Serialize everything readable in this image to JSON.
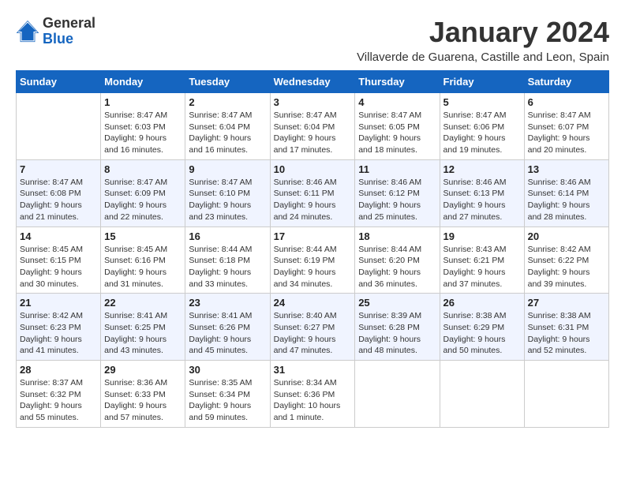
{
  "logo": {
    "general": "General",
    "blue": "Blue"
  },
  "title": "January 2024",
  "subtitle": "Villaverde de Guarena, Castille and Leon, Spain",
  "headers": [
    "Sunday",
    "Monday",
    "Tuesday",
    "Wednesday",
    "Thursday",
    "Friday",
    "Saturday"
  ],
  "weeks": [
    [
      {
        "day": "",
        "info": ""
      },
      {
        "day": "1",
        "info": "Sunrise: 8:47 AM\nSunset: 6:03 PM\nDaylight: 9 hours\nand 16 minutes."
      },
      {
        "day": "2",
        "info": "Sunrise: 8:47 AM\nSunset: 6:04 PM\nDaylight: 9 hours\nand 16 minutes."
      },
      {
        "day": "3",
        "info": "Sunrise: 8:47 AM\nSunset: 6:04 PM\nDaylight: 9 hours\nand 17 minutes."
      },
      {
        "day": "4",
        "info": "Sunrise: 8:47 AM\nSunset: 6:05 PM\nDaylight: 9 hours\nand 18 minutes."
      },
      {
        "day": "5",
        "info": "Sunrise: 8:47 AM\nSunset: 6:06 PM\nDaylight: 9 hours\nand 19 minutes."
      },
      {
        "day": "6",
        "info": "Sunrise: 8:47 AM\nSunset: 6:07 PM\nDaylight: 9 hours\nand 20 minutes."
      }
    ],
    [
      {
        "day": "7",
        "info": "Sunrise: 8:47 AM\nSunset: 6:08 PM\nDaylight: 9 hours\nand 21 minutes."
      },
      {
        "day": "8",
        "info": "Sunrise: 8:47 AM\nSunset: 6:09 PM\nDaylight: 9 hours\nand 22 minutes."
      },
      {
        "day": "9",
        "info": "Sunrise: 8:47 AM\nSunset: 6:10 PM\nDaylight: 9 hours\nand 23 minutes."
      },
      {
        "day": "10",
        "info": "Sunrise: 8:46 AM\nSunset: 6:11 PM\nDaylight: 9 hours\nand 24 minutes."
      },
      {
        "day": "11",
        "info": "Sunrise: 8:46 AM\nSunset: 6:12 PM\nDaylight: 9 hours\nand 25 minutes."
      },
      {
        "day": "12",
        "info": "Sunrise: 8:46 AM\nSunset: 6:13 PM\nDaylight: 9 hours\nand 27 minutes."
      },
      {
        "day": "13",
        "info": "Sunrise: 8:46 AM\nSunset: 6:14 PM\nDaylight: 9 hours\nand 28 minutes."
      }
    ],
    [
      {
        "day": "14",
        "info": "Sunrise: 8:45 AM\nSunset: 6:15 PM\nDaylight: 9 hours\nand 30 minutes."
      },
      {
        "day": "15",
        "info": "Sunrise: 8:45 AM\nSunset: 6:16 PM\nDaylight: 9 hours\nand 31 minutes."
      },
      {
        "day": "16",
        "info": "Sunrise: 8:44 AM\nSunset: 6:18 PM\nDaylight: 9 hours\nand 33 minutes."
      },
      {
        "day": "17",
        "info": "Sunrise: 8:44 AM\nSunset: 6:19 PM\nDaylight: 9 hours\nand 34 minutes."
      },
      {
        "day": "18",
        "info": "Sunrise: 8:44 AM\nSunset: 6:20 PM\nDaylight: 9 hours\nand 36 minutes."
      },
      {
        "day": "19",
        "info": "Sunrise: 8:43 AM\nSunset: 6:21 PM\nDaylight: 9 hours\nand 37 minutes."
      },
      {
        "day": "20",
        "info": "Sunrise: 8:42 AM\nSunset: 6:22 PM\nDaylight: 9 hours\nand 39 minutes."
      }
    ],
    [
      {
        "day": "21",
        "info": "Sunrise: 8:42 AM\nSunset: 6:23 PM\nDaylight: 9 hours\nand 41 minutes."
      },
      {
        "day": "22",
        "info": "Sunrise: 8:41 AM\nSunset: 6:25 PM\nDaylight: 9 hours\nand 43 minutes."
      },
      {
        "day": "23",
        "info": "Sunrise: 8:41 AM\nSunset: 6:26 PM\nDaylight: 9 hours\nand 45 minutes."
      },
      {
        "day": "24",
        "info": "Sunrise: 8:40 AM\nSunset: 6:27 PM\nDaylight: 9 hours\nand 47 minutes."
      },
      {
        "day": "25",
        "info": "Sunrise: 8:39 AM\nSunset: 6:28 PM\nDaylight: 9 hours\nand 48 minutes."
      },
      {
        "day": "26",
        "info": "Sunrise: 8:38 AM\nSunset: 6:29 PM\nDaylight: 9 hours\nand 50 minutes."
      },
      {
        "day": "27",
        "info": "Sunrise: 8:38 AM\nSunset: 6:31 PM\nDaylight: 9 hours\nand 52 minutes."
      }
    ],
    [
      {
        "day": "28",
        "info": "Sunrise: 8:37 AM\nSunset: 6:32 PM\nDaylight: 9 hours\nand 55 minutes."
      },
      {
        "day": "29",
        "info": "Sunrise: 8:36 AM\nSunset: 6:33 PM\nDaylight: 9 hours\nand 57 minutes."
      },
      {
        "day": "30",
        "info": "Sunrise: 8:35 AM\nSunset: 6:34 PM\nDaylight: 9 hours\nand 59 minutes."
      },
      {
        "day": "31",
        "info": "Sunrise: 8:34 AM\nSunset: 6:36 PM\nDaylight: 10 hours\nand 1 minute."
      },
      {
        "day": "",
        "info": ""
      },
      {
        "day": "",
        "info": ""
      },
      {
        "day": "",
        "info": ""
      }
    ]
  ]
}
